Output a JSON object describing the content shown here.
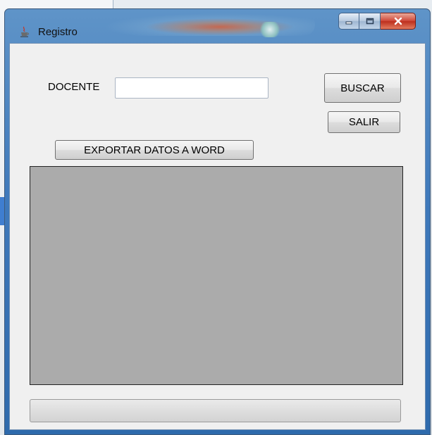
{
  "window": {
    "title": "Registro",
    "icon": "java-cup-icon"
  },
  "caption_buttons": {
    "minimize_icon": "minimize-icon",
    "maximize_icon": "maximize-icon",
    "close_icon": "close-icon"
  },
  "form": {
    "docente_label": "DOCENTE",
    "docente_value": "",
    "buscar_label": "BUSCAR",
    "salir_label": "SALIR",
    "exportar_label": "EXPORTAR DATOS A WORD"
  },
  "progress": {
    "value": 0
  },
  "colors": {
    "titlebar": "#3f79bb",
    "client_bg": "#f0f0f0",
    "grid_bg": "#ababab",
    "close_button": "#c7392a"
  }
}
